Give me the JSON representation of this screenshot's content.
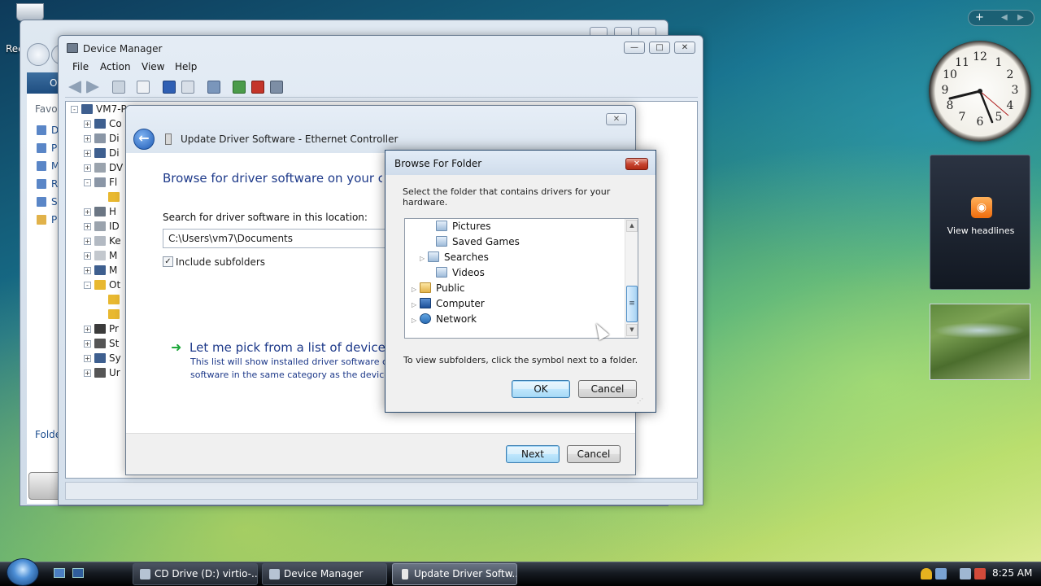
{
  "desktop": {
    "recycle_label": "Rec"
  },
  "explorer": {
    "organize": "O",
    "favorites_label": "Favori",
    "favorites": [
      "De",
      "Pi",
      "M",
      "Re",
      "Se",
      "Pu"
    ],
    "folders_label": "Folde"
  },
  "device_manager": {
    "title": "Device Manager",
    "window_controls": {
      "minimize": "—",
      "maximize": "□",
      "close": "✕"
    },
    "menu": [
      "File",
      "Action",
      "View",
      "Help"
    ],
    "tree": [
      {
        "label": "VM7-P",
        "expander": "-"
      },
      {
        "label": "Co",
        "expander": "+"
      },
      {
        "label": "Di",
        "expander": "+"
      },
      {
        "label": "Di",
        "expander": "+"
      },
      {
        "label": "DV",
        "expander": "+"
      },
      {
        "label": "Fl",
        "expander": "-"
      },
      {
        "label": "",
        "expander": ""
      },
      {
        "label": "H",
        "expander": "+"
      },
      {
        "label": "ID",
        "expander": "+"
      },
      {
        "label": "Ke",
        "expander": "+"
      },
      {
        "label": "M",
        "expander": "+"
      },
      {
        "label": "M",
        "expander": "+"
      },
      {
        "label": "Ot",
        "expander": "-"
      },
      {
        "label": "",
        "expander": ""
      },
      {
        "label": "",
        "expander": ""
      },
      {
        "label": "Pr",
        "expander": "+"
      },
      {
        "label": "St",
        "expander": "+"
      },
      {
        "label": "Sy",
        "expander": "+"
      },
      {
        "label": "Ur",
        "expander": "+"
      }
    ]
  },
  "update_dialog": {
    "title": "Update Driver Software - Ethernet Controller",
    "close": "✕",
    "back": "←",
    "heading": "Browse for driver software on your computer",
    "search_label": "Search for driver software in this location:",
    "path_value": "C:\\Users\\vm7\\Documents",
    "include_subfolders": {
      "label": "Include subfolders",
      "checked": true,
      "mark": "✓"
    },
    "pick_arrow": "➜",
    "pick_title": "Let me pick from a list of device drivers on my computer",
    "pick_desc_1": "This list will show installed driver software compatible with the device, and all driver",
    "pick_desc_2": "software in the same category as the device.",
    "next": "Next",
    "cancel": "Cancel"
  },
  "browse_dialog": {
    "title": "Browse For Folder",
    "close": "✕",
    "instruction": "Select the folder that contains drivers for your hardware.",
    "folders": [
      {
        "label": "Pictures",
        "icon": "library-folder-icon",
        "expandable": false,
        "indent": 1
      },
      {
        "label": "Saved Games",
        "icon": "library-folder-icon",
        "expandable": false,
        "indent": 1
      },
      {
        "label": "Searches",
        "icon": "library-folder-icon",
        "expandable": true,
        "indent": 1
      },
      {
        "label": "Videos",
        "icon": "library-folder-icon",
        "expandable": false,
        "indent": 1
      },
      {
        "label": "Public",
        "icon": "folder-icon",
        "expandable": true,
        "indent": 0
      },
      {
        "label": "Computer",
        "icon": "computer-icon",
        "expandable": true,
        "indent": 0
      },
      {
        "label": "Network",
        "icon": "network-icon",
        "expandable": true,
        "indent": 0
      }
    ],
    "expander_glyph": "▷",
    "scroll_up": "▲",
    "scroll_down": "▼",
    "thumb_grip": "≡",
    "hint": "To view subfolders, click the symbol next to a folder.",
    "ok": "OK",
    "cancel": "Cancel",
    "grip": "⋰"
  },
  "sidebar": {
    "plus": "+",
    "prev": "◀",
    "next": "▶",
    "clock_numbers": [
      "12",
      "1",
      "2",
      "3",
      "4",
      "5",
      "6",
      "7",
      "8",
      "9",
      "10",
      "11"
    ],
    "rss_label": "View headlines",
    "rss_glyph": "◉"
  },
  "taskbar": {
    "tasks": [
      {
        "label": "CD Drive (D:) virtio-...",
        "active": false
      },
      {
        "label": "Device Manager",
        "active": false
      },
      {
        "label": "Update Driver Softw...",
        "active": true
      }
    ],
    "time": "8:25 AM"
  },
  "colors": {
    "accent_text": "#1e3a8a",
    "default_button_border": "#3c7fb1",
    "close_red": "#c74430"
  }
}
